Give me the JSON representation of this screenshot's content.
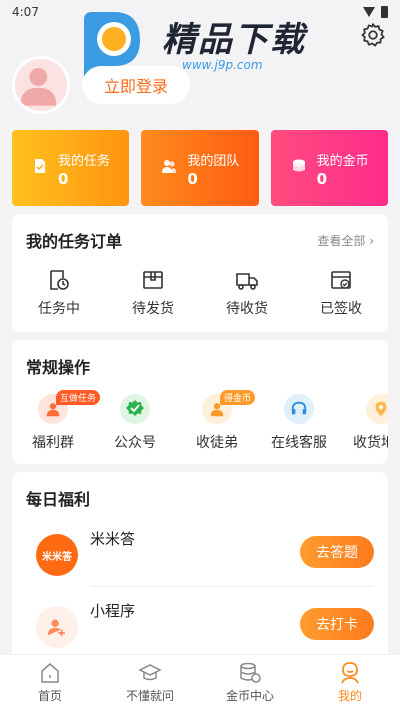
{
  "status_bar": {
    "time": "4:07"
  },
  "watermark": {
    "text": "精品下载",
    "url": "www.j9p.com"
  },
  "profile": {
    "login_label": "立即登录"
  },
  "stats": [
    {
      "label": "我的任务",
      "value": "0",
      "icon": "task-icon"
    },
    {
      "label": "我的团队",
      "value": "0",
      "icon": "team-icon"
    },
    {
      "label": "我的金币",
      "value": "0",
      "icon": "coin-icon"
    }
  ],
  "orders": {
    "title": "我的任务订单",
    "view_all": "查看全部 ›",
    "items": [
      {
        "label": "任务中",
        "icon": "clock-doc-icon"
      },
      {
        "label": "待发货",
        "icon": "box-icon"
      },
      {
        "label": "待收货",
        "icon": "truck-icon"
      },
      {
        "label": "已签收",
        "icon": "signed-box-icon"
      }
    ]
  },
  "ops": {
    "title": "常规操作",
    "items": [
      {
        "label": "福利群",
        "badge": "互做任务",
        "icon": "group-icon"
      },
      {
        "label": "公众号",
        "badge": "",
        "icon": "check-badge-icon"
      },
      {
        "label": "收徒弟",
        "badge": "得金币",
        "icon": "user-plus-icon"
      },
      {
        "label": "在线客服",
        "badge": "",
        "icon": "headset-icon"
      },
      {
        "label": "收货地址",
        "badge": "",
        "icon": "location-icon"
      }
    ]
  },
  "welfare": {
    "title": "每日福利",
    "items": [
      {
        "name": "米米答",
        "logo_text": "米米答",
        "button": "去答题"
      },
      {
        "name": "小程序",
        "logo_text": "",
        "button": "去打卡"
      }
    ]
  },
  "tabbar": [
    {
      "label": "首页",
      "icon": "home-icon",
      "active": false
    },
    {
      "label": "不懂就问",
      "icon": "graduation-cap-icon",
      "active": false
    },
    {
      "label": "金币中心",
      "icon": "coin-stack-icon",
      "active": false
    },
    {
      "label": "我的",
      "icon": "profile-icon",
      "active": true
    }
  ],
  "colors": {
    "accent": "#ff8a1e",
    "login_text": "#ff6a1a"
  }
}
